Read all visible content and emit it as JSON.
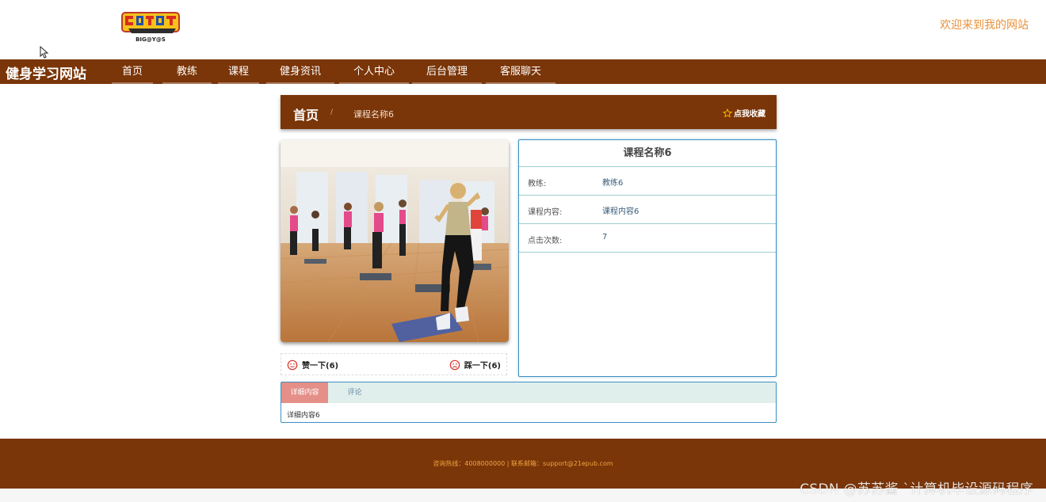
{
  "header": {
    "logo_alt": "DIGIMON ADVENTURE BIG@Y@S",
    "logo_text": "BIG@Y@S",
    "welcome": "欢迎来到我的网站"
  },
  "nav": {
    "brand": "健身学习网站",
    "items": [
      "首页",
      "教练",
      "课程",
      "健身资讯",
      "个人中心",
      "后台管理",
      "客服聊天"
    ]
  },
  "breadcrumb": {
    "home": "首页",
    "separator": "/",
    "current": "课程名称6",
    "favorite": "点我收藏"
  },
  "course": {
    "title": "课程名称6",
    "fields": [
      {
        "label": "教练:",
        "value": "教练6"
      },
      {
        "label": "课程内容:",
        "value": "课程内容6"
      },
      {
        "label": "点击次数:",
        "value": "7"
      }
    ],
    "like": "赞一下(6)",
    "dislike": "踩一下(6)"
  },
  "tabs": {
    "items": [
      "详细内容",
      "评论"
    ],
    "active_content": "详细内容6"
  },
  "footer": {
    "text": "咨询热线：4008000000 | 联系邮箱：support@21epub.com"
  },
  "watermark": "CSDN @苏苏酱  `计算机毕设源码程序",
  "colors": {
    "nav_bg": "#7a3508",
    "accent_orange": "#e8913b",
    "info_border": "#3c8fc2",
    "tab_active": "#e48f88"
  }
}
